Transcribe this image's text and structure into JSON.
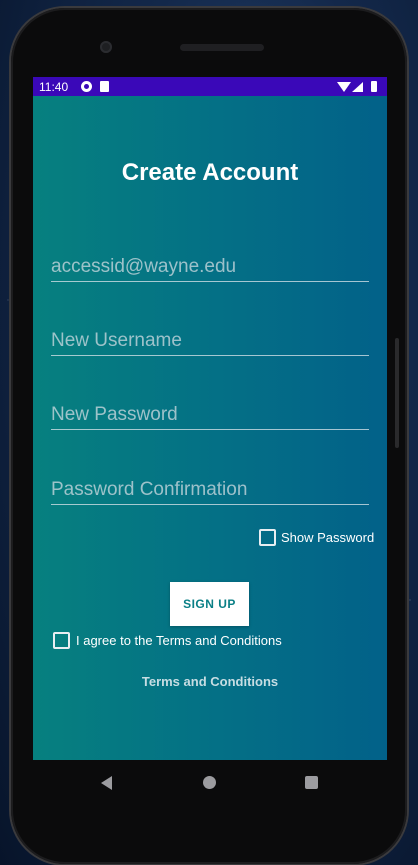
{
  "status_bar": {
    "time": "11:40"
  },
  "screen": {
    "title": "Create Account",
    "fields": {
      "email_placeholder": "accessid@wayne.edu",
      "username_placeholder": "New Username",
      "password_placeholder": "New Password",
      "confirm_placeholder": "Password Confirmation"
    },
    "show_password_label": "Show Password",
    "signup_label": "SIGN UP",
    "agree_label": "I agree to the Terms and Conditions",
    "terms_link": "Terms and Conditions"
  },
  "icons": {
    "status": [
      "app-notification-icon",
      "sd-card-icon",
      "wifi-icon",
      "signal-icon",
      "battery-icon"
    ],
    "nav": [
      "back-icon",
      "home-icon",
      "recents-icon"
    ]
  },
  "colors": {
    "status_bar": "#3a08b8",
    "gradient_start": "#06807f",
    "gradient_end": "#026189",
    "button_text": "#0a7f86"
  }
}
